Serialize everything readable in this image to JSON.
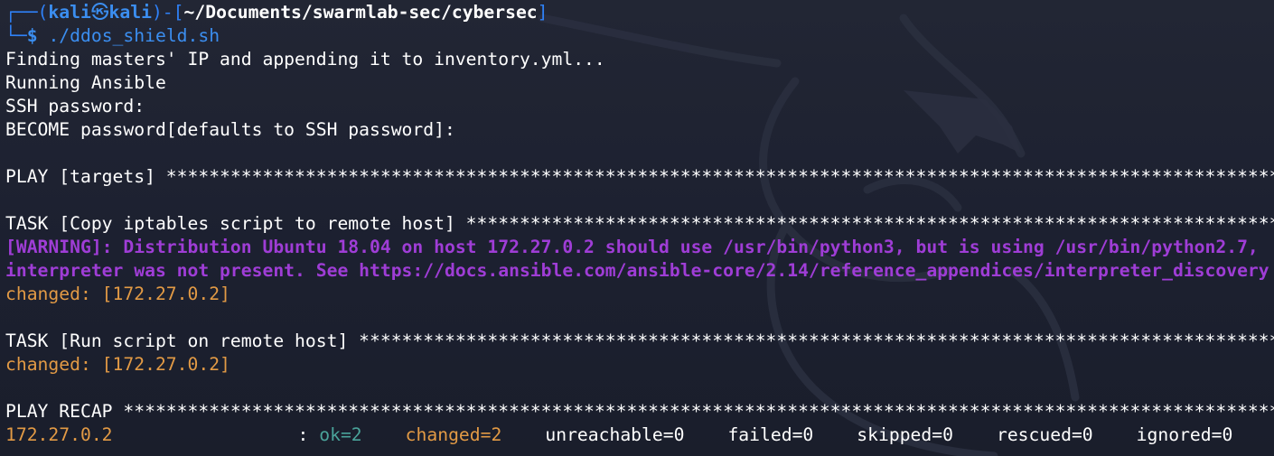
{
  "prompt": {
    "frame_top": "┌──(",
    "user": "kali",
    "skull": "㉿",
    "host": "kali",
    "sep_open": ")-[",
    "path": "~/Documents/swarmlab-sec/cybersec",
    "sep_close": "]",
    "frame_bottom": "└─",
    "dollar": "$",
    "command": "./ddos_shield.sh"
  },
  "output": {
    "line1": "Finding masters' IP and appending it to inventory.yml...",
    "line2": "Running Ansible",
    "line3": "SSH password:",
    "line4": "BECOME password[defaults to SSH password]:",
    "play_targets": "PLAY [targets] **********************************************************************************************************************",
    "task_copy": "TASK [Copy iptables script to remote host] *********************************************************************************",
    "warning1": "[WARNING]: Distribution Ubuntu 18.04 on host 172.27.0.2 should use /usr/bin/python3, but is using /usr/bin/python2.7,",
    "warning2": "interpreter was not present. See https://docs.ansible.com/ansible-core/2.14/reference_appendices/interpreter_discovery",
    "changed1": "changed: [172.27.0.2]",
    "task_run": "TASK [Run script on remote host] ***********************************************************************************************",
    "changed2": "changed: [172.27.0.2]",
    "play_recap": "PLAY RECAP *****************************************************************************************************************************"
  },
  "recap": {
    "host": "172.27.0.2",
    "colon": ":",
    "ok": "ok=2",
    "changed": "changed=2",
    "unreachable": "unreachable=0",
    "failed": "failed=0",
    "skipped": "skipped=0",
    "rescued": "rescued=0",
    "ignored": "ignored=0"
  },
  "colors": {
    "background": "#1c2030",
    "prompt_blue": "#3b8ef0",
    "warning_purple": "#9f3dd6",
    "changed_orange": "#e29a45",
    "ok_teal": "#4aa39a"
  },
  "icons": {
    "watermark": "kali-dragon-logo"
  }
}
